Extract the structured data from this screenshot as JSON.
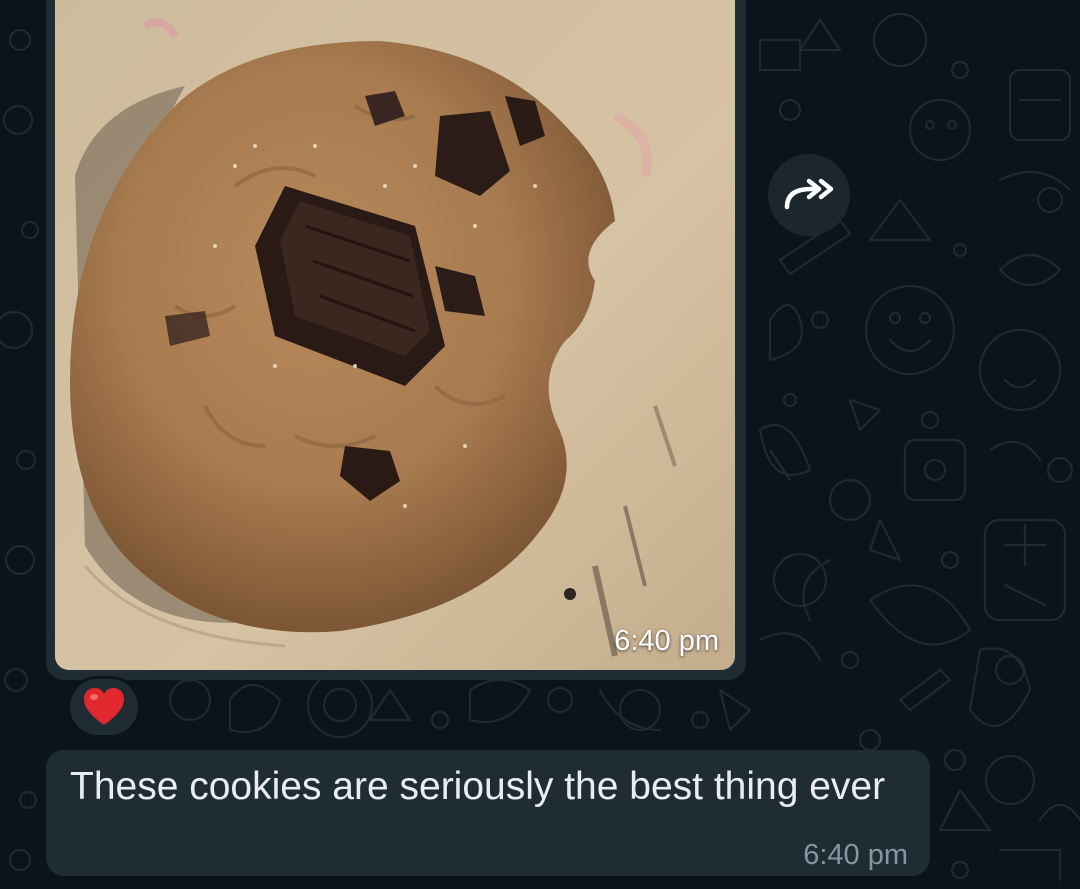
{
  "conversation": {
    "image_message": {
      "time": "6:40 pm",
      "reaction": "❤️"
    },
    "text_message": {
      "text": "These cookies are seriously the best thing ever",
      "time": "6:40 pm"
    },
    "icons": {
      "forward": "forward-icon",
      "reaction": "heart-reaction-icon"
    }
  },
  "colors": {
    "chat_background": "#0b141a",
    "bubble_incoming": "#1f2c34",
    "text_primary": "#e9edef",
    "text_secondary": "#8696a0"
  }
}
